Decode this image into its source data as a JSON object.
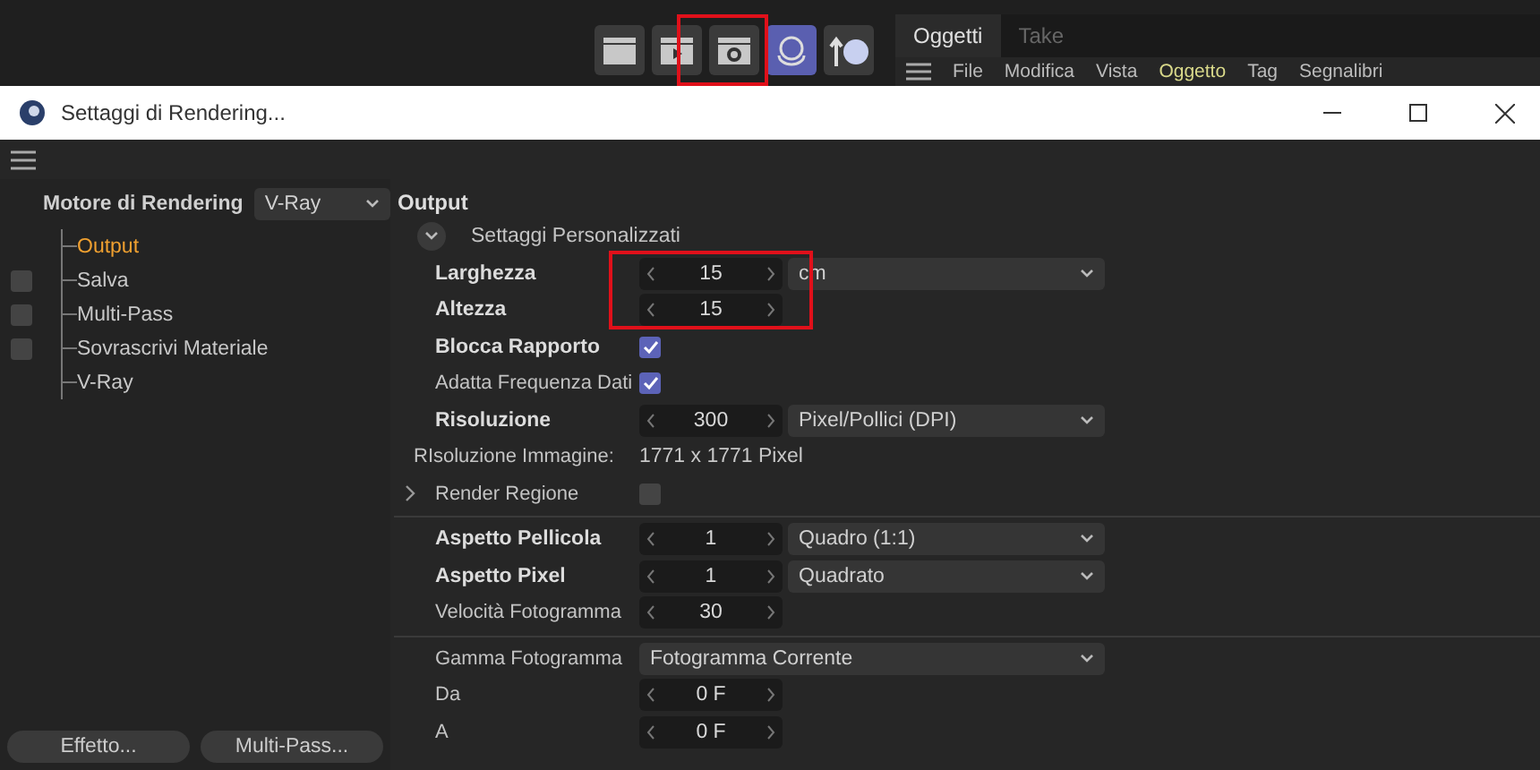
{
  "toolbar": {
    "panel_tabs": [
      {
        "label": "Oggetti",
        "selected": true
      },
      {
        "label": "Take",
        "selected": false
      }
    ],
    "menu": [
      {
        "label": "File",
        "highlighted": false
      },
      {
        "label": "Modifica",
        "highlighted": false
      },
      {
        "label": "Vista",
        "highlighted": false
      },
      {
        "label": "Oggetto",
        "highlighted": true
      },
      {
        "label": "Tag",
        "highlighted": false
      },
      {
        "label": "Segnalibri",
        "highlighted": false
      }
    ]
  },
  "window": {
    "title": "Settaggi di Rendering..."
  },
  "sidebar": {
    "engine_label": "Motore di Rendering",
    "engine": "V-Ray",
    "items": [
      {
        "label": "Output",
        "selected": true
      },
      {
        "label": "Salva",
        "selected": false,
        "checked": false
      },
      {
        "label": "Multi-Pass",
        "selected": false,
        "checked": false
      },
      {
        "label": "Sovrascrivi Materiale",
        "selected": false,
        "checked": false
      },
      {
        "label": "V-Ray",
        "selected": false
      }
    ],
    "buttons": [
      "Effetto...",
      "Multi-Pass..."
    ]
  },
  "panel": {
    "title": "Output",
    "group": {
      "label": "Settaggi Personalizzati",
      "expanded": true
    },
    "sections": [
      {
        "rows": [
          {
            "kind": "spinner",
            "label": "Larghezza",
            "bold": true,
            "value": "15",
            "option": "cm"
          },
          {
            "kind": "spinner",
            "label": "Altezza",
            "bold": true,
            "value": "15"
          },
          {
            "kind": "checkbox",
            "label": "Blocca Rapporto",
            "bold": true,
            "checked": true
          },
          {
            "kind": "checkbox",
            "label": "Adatta Frequenza Dati",
            "bold": false,
            "checked": true
          },
          {
            "kind": "spinner",
            "label": "Risoluzione",
            "bold": true,
            "value": "300",
            "option": "Pixel/Pollici (DPI)"
          },
          {
            "kind": "info",
            "label": "RIsoluzione Immagine:",
            "bold": false,
            "value": "1771 x 1771 Pixel"
          },
          {
            "kind": "expander",
            "label": "Render Regione",
            "bold": false,
            "checked": false
          }
        ]
      },
      {
        "rows": [
          {
            "kind": "spinner",
            "label": "Aspetto Pellicola",
            "bold": true,
            "value": "1",
            "option": "Quadro (1:1)"
          },
          {
            "kind": "spinner",
            "label": "Aspetto Pixel",
            "bold": true,
            "value": "1",
            "option": "Quadrato"
          },
          {
            "kind": "spinner",
            "label": "Velocità Fotogramma",
            "bold": false,
            "value": "30"
          }
        ]
      },
      {
        "rows": [
          {
            "kind": "dropdown",
            "label": "Gamma Fotogramma",
            "bold": false,
            "option": "Fotogramma Corrente"
          },
          {
            "kind": "spinner",
            "label": "Da",
            "bold": false,
            "value": "0 F"
          },
          {
            "kind": "spinner",
            "label": "A",
            "bold": false,
            "value": "0 F"
          }
        ]
      }
    ]
  }
}
